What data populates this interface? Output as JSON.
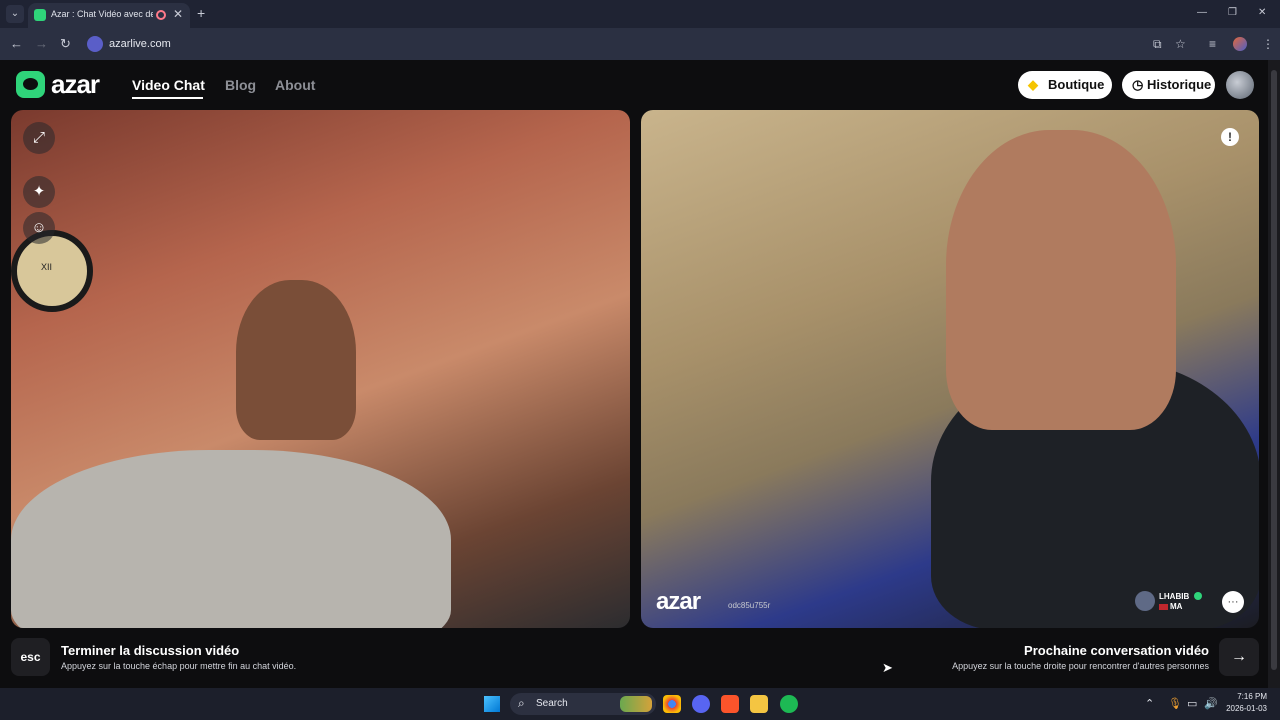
{
  "browser": {
    "tab_title": "Azar : Chat Vidéo avec de n",
    "url": "azarlive.com",
    "new_tab": "+",
    "tab_close": "✕"
  },
  "header": {
    "logo_text": "azar",
    "nav": [
      {
        "label": "Video Chat",
        "active": true
      },
      {
        "label": "Blog",
        "active": false
      },
      {
        "label": "About",
        "active": false
      }
    ],
    "boutique_label": "Boutique",
    "historique_label": "Historique"
  },
  "left_video": {
    "clock_label": "XII"
  },
  "right_video": {
    "report_label": "!",
    "watermark": "azar",
    "stream_id": "odc85u755r",
    "peer_name": "LHABIB",
    "peer_country": "MA",
    "peer_flag_color": "#c1272d"
  },
  "hints": {
    "esc_key": "esc",
    "end_title": "Terminer la discussion vidéo",
    "end_sub": "Appuyez sur la touche échap pour mettre fin au chat vidéo.",
    "next_title": "Prochaine conversation vidéo",
    "next_sub": "Appuyez sur la touche droite pour rencontrer d'autres personnes",
    "next_key": "→"
  },
  "taskbar": {
    "search_label": "Search",
    "time": "7:16 PM",
    "date": "2026-01-03"
  },
  "colors": {
    "brand": "#2fd47a",
    "background": "#0d0d0f"
  },
  "icons": {
    "expand": "expand-icon",
    "effects": "sparkles-icon",
    "face": "face-icon",
    "report": "report-icon",
    "chat": "chat-bubble-icon",
    "diamond": "diamond-icon",
    "clock": "clock-icon"
  }
}
